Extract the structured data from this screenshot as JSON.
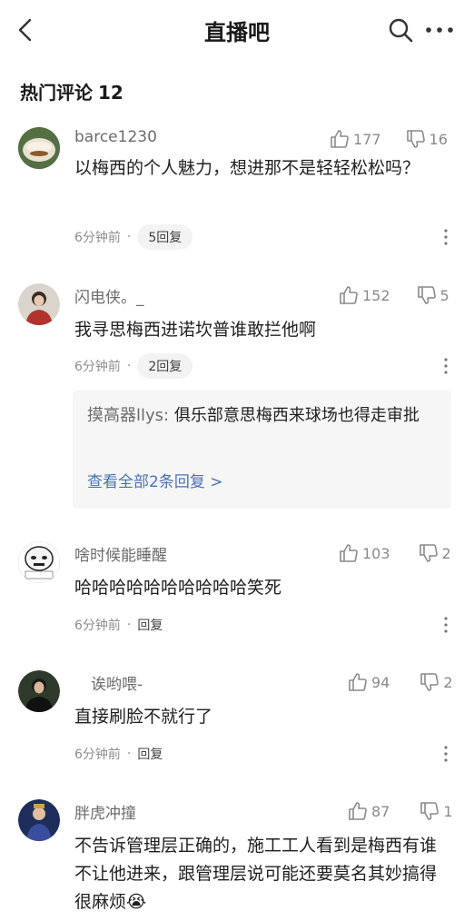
{
  "header": {
    "title": "直播吧",
    "back_icon": "chevron-left-icon",
    "search_icon": "search-icon",
    "more_icon": "ellipsis-icon"
  },
  "section": {
    "title": "热门评论",
    "count": "12"
  },
  "comments": [
    {
      "user": "barce1230",
      "likes": "177",
      "dislikes": "16",
      "text": "以梅西的个人魅力，想进那不是轻轻松松吗？",
      "time": "6分钟前",
      "reply": "5回复"
    },
    {
      "user": "闪电侠。_",
      "likes": "152",
      "dislikes": "5",
      "text": "我寻思梅西进诺坎普谁敢拦他啊",
      "time": "6分钟前",
      "reply": "2回复",
      "sub_reply": {
        "user": "摸高器llys:",
        "text": "俱乐部意思梅西来球场也得走审批",
        "more": "查看全部2条回复 >"
      }
    },
    {
      "user": "啥时候能睡醒",
      "likes": "103",
      "dislikes": "2",
      "text": "哈哈哈哈哈哈哈哈哈哈笑死",
      "time": "6分钟前",
      "reply": "回复"
    },
    {
      "user": "诶哟喂-",
      "likes": "94",
      "dislikes": "2",
      "text": "直接刷脸不就行了",
      "time": "6分钟前",
      "reply": "回复"
    },
    {
      "user": "胖虎冲撞",
      "likes": "87",
      "dislikes": "1",
      "text": "不告诉管理层正确的，施工工人看到是梅西有谁不让他进来，跟管理层说可能还要莫名其妙搞得很麻烦",
      "emoji": "😭"
    }
  ],
  "meta_separator": "·",
  "colors": {
    "link": "#4a72b4",
    "muted": "#8a8a8a",
    "pill_bg": "#f3f3f3",
    "subbox_bg": "#f6f6f6"
  }
}
